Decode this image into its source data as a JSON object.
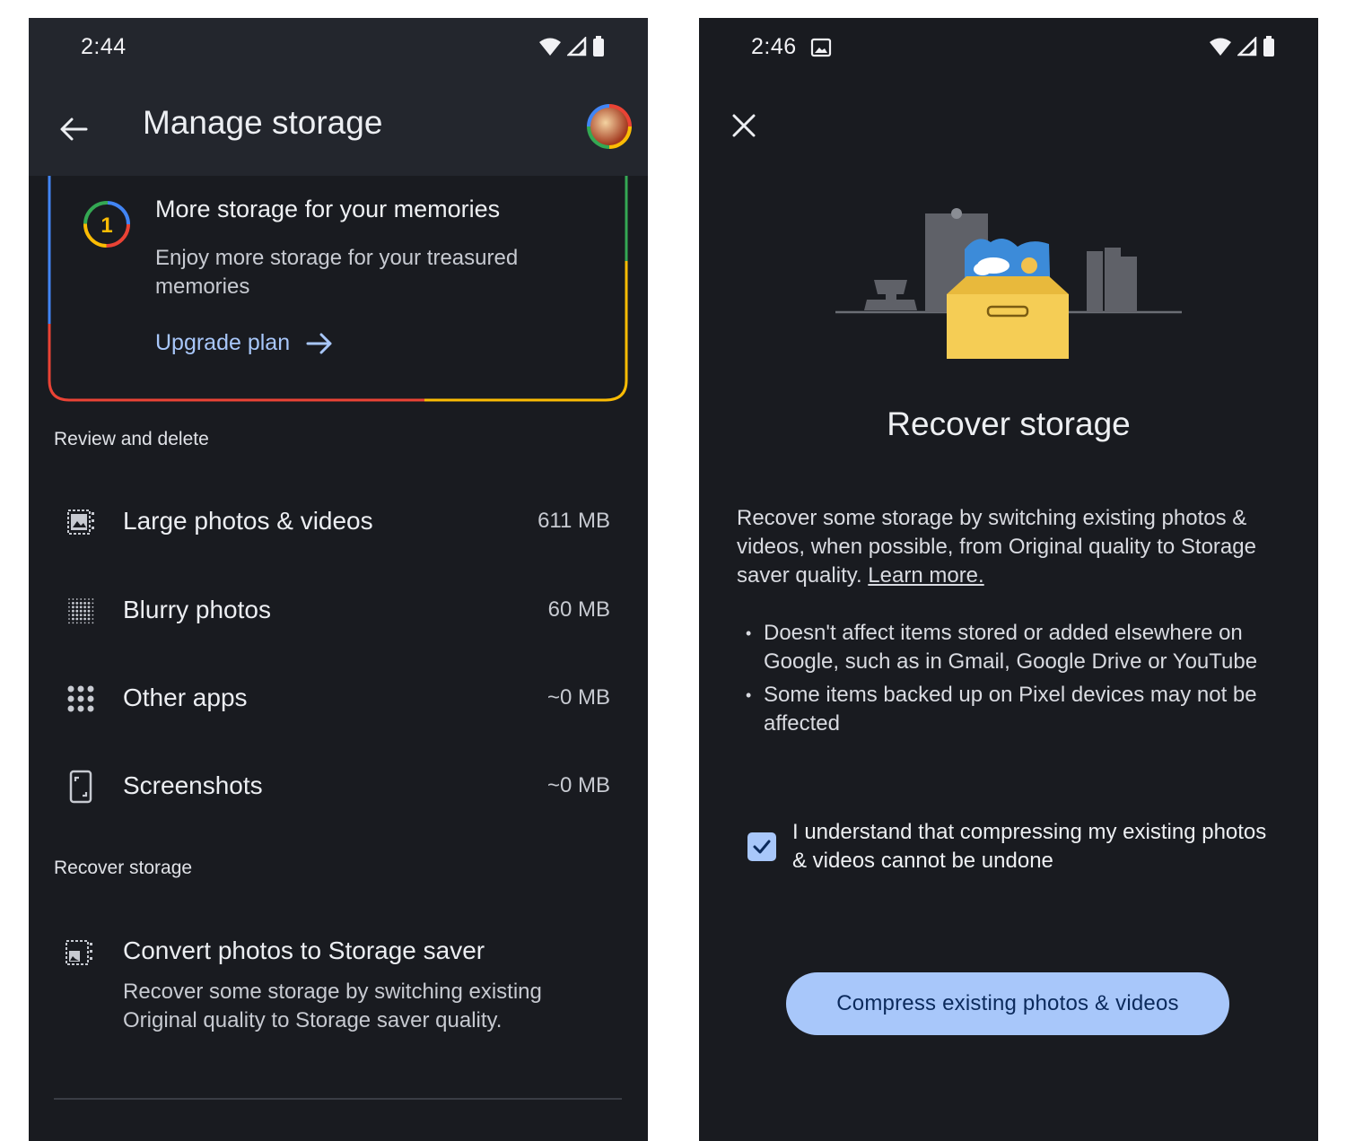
{
  "left_screen": {
    "status_time": "2:44",
    "app_bar": {
      "title": "Manage storage",
      "back_icon": "arrow-back-icon",
      "avatar": "account-avatar"
    },
    "promo": {
      "title": "More storage for your memories",
      "description": "Enjoy more storage for your treasured memories",
      "link_label": "Upgrade plan",
      "badge_text": "1",
      "colors": {
        "blue": "#4285f4",
        "red": "#ea4335",
        "yellow": "#fbbc04",
        "green": "#34a853"
      }
    },
    "review_section": {
      "label": "Review and delete",
      "items": [
        {
          "label": "Large photos & videos",
          "value": "611 MB",
          "icon": "large-photo-icon"
        },
        {
          "label": "Blurry photos",
          "value": "60 MB",
          "icon": "blurry-grid-icon"
        },
        {
          "label": "Other apps",
          "value": "~0 MB",
          "icon": "apps-grid-icon"
        },
        {
          "label": "Screenshots",
          "value": "~0 MB",
          "icon": "screenshot-icon"
        }
      ]
    },
    "recover_section": {
      "label": "Recover storage",
      "convert_title": "Convert photos to Storage saver",
      "convert_description": "Recover some storage by switching existing Original quality to Storage saver quality."
    }
  },
  "right_screen": {
    "status_time": "2:46",
    "close_icon": "close-icon",
    "title": "Recover storage",
    "body": "Recover some storage by switching existing photos & videos, when possible, from Original quality to Storage saver quality.",
    "learn_more": "Learn more.",
    "bullets": [
      "Doesn't affect items stored or added elsewhere on Google, such as in Gmail, Google Drive or YouTube",
      "Some items backed up on Pixel devices may not be affected"
    ],
    "confirm_text": "I understand that compressing my existing photos & videos cannot be undone",
    "confirm_checked": true,
    "primary_button": "Compress existing photos & videos"
  },
  "theme": {
    "background": "#191b20",
    "app_bar": "#23262d",
    "accent": "#a8c7fa"
  }
}
